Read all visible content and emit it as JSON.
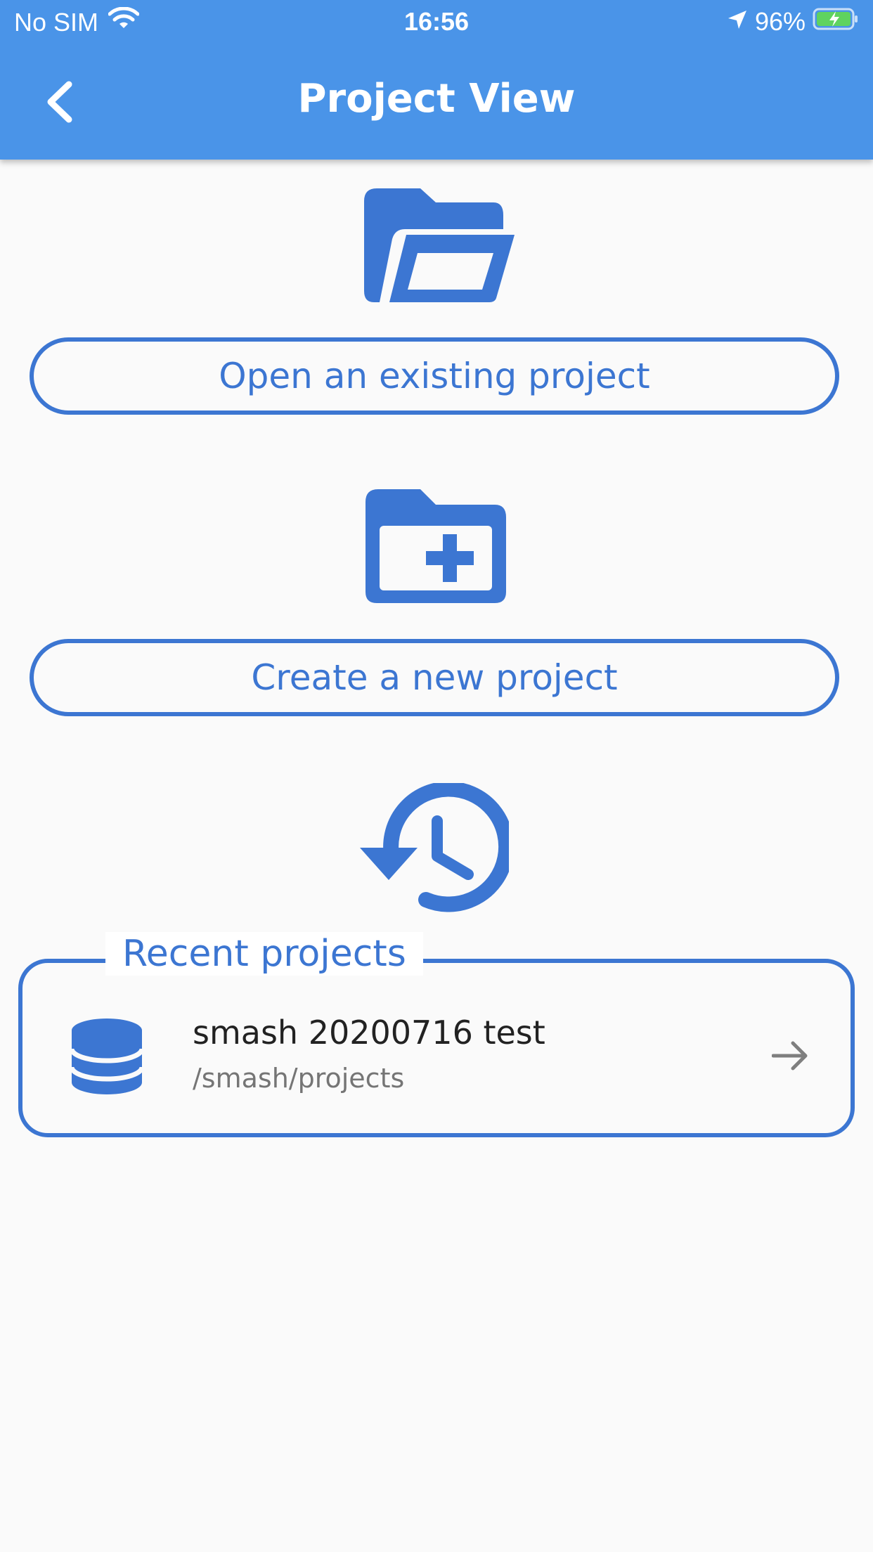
{
  "status_bar": {
    "carrier": "No SIM",
    "time": "16:56",
    "battery": "96%"
  },
  "app_bar": {
    "title": "Project View"
  },
  "actions": {
    "open_label": "Open an existing project",
    "create_label": "Create a new project"
  },
  "recent": {
    "legend": "Recent projects",
    "projects": [
      {
        "name": "smash 20200716 test",
        "path": "/smash/projects"
      }
    ]
  },
  "colors": {
    "app_bar": "#4a94e8",
    "accent": "#3c76d2",
    "background": "#fafafa"
  }
}
